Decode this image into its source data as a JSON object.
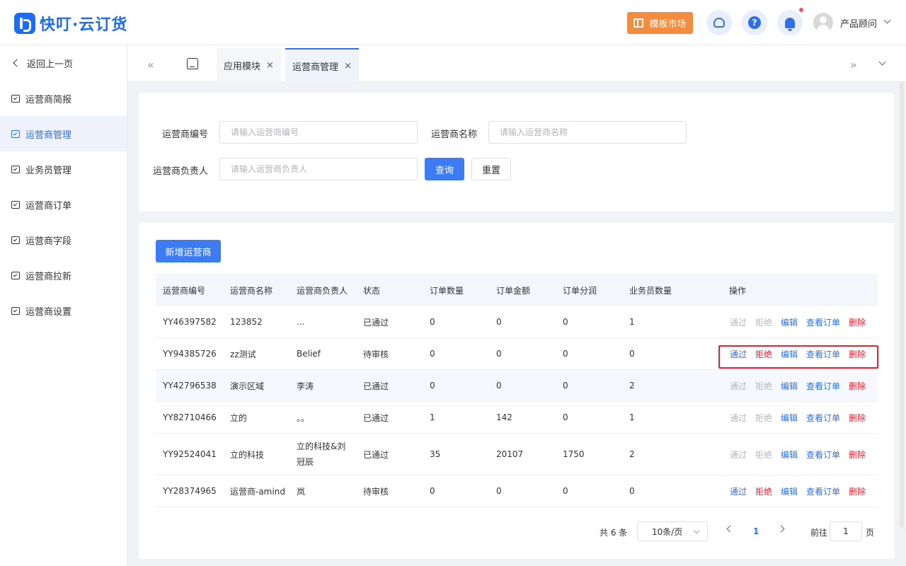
{
  "header": {
    "logo_text": "快叮·云订货",
    "template_market": "模板市场",
    "help_glyph": "?",
    "user_name": "产品顾问"
  },
  "sidebar": {
    "back": "返回上一页",
    "items": [
      {
        "label": "运营商简报"
      },
      {
        "label": "运营商管理"
      },
      {
        "label": "业务员管理"
      },
      {
        "label": "运营商订单"
      },
      {
        "label": "运营商字段"
      },
      {
        "label": "运营商拉新"
      },
      {
        "label": "运营商设置"
      }
    ]
  },
  "tabs": {
    "prev": "«",
    "next": "»",
    "close": "×",
    "items": [
      {
        "label": "应用模块"
      },
      {
        "label": "运营商管理"
      }
    ]
  },
  "filters": {
    "code_label": "运营商编号",
    "code_placeholder": "请输入运营商编号",
    "name_label": "运营商名称",
    "name_placeholder": "请输入运营商名称",
    "owner_label": "运营商负责人",
    "owner_placeholder": "请输入运营商负责人",
    "query": "查询",
    "reset": "重置"
  },
  "toolbar": {
    "add": "新增运营商"
  },
  "table": {
    "columns": [
      "运营商编号",
      "运营商名称",
      "运营商负责人",
      "状态",
      "订单数量",
      "订单金额",
      "订单分润",
      "业务员数量",
      "操作"
    ],
    "actions": {
      "approve": "通过",
      "reject": "拒绝",
      "edit": "编辑",
      "view_orders": "查看订单",
      "delete": "删除"
    },
    "rows": [
      {
        "code": "YY46397582",
        "name": "123852",
        "owner": "...",
        "status": "已通过",
        "orders": "0",
        "amount": "0",
        "profit": "0",
        "staff": "1"
      },
      {
        "code": "YY94385726",
        "name": "zz测试",
        "owner": "Belief",
        "status": "待审核",
        "orders": "0",
        "amount": "0",
        "profit": "0",
        "staff": "0"
      },
      {
        "code": "YY42796538",
        "name": "演示区域",
        "owner": "李涛",
        "status": "已通过",
        "orders": "0",
        "amount": "0",
        "profit": "0",
        "staff": "2"
      },
      {
        "code": "YY82710466",
        "name": "立的",
        "owner": "。。",
        "status": "已通过",
        "orders": "1",
        "amount": "142",
        "profit": "0",
        "staff": "1"
      },
      {
        "code": "YY92524041",
        "name": "立的科技",
        "owner": "立的科技&刘冠辰",
        "status": "已通过",
        "orders": "35",
        "amount": "20107",
        "profit": "1750",
        "staff": "2"
      },
      {
        "code": "YY28374965",
        "name": "运营商-amind",
        "owner": "岚",
        "status": "待审核",
        "orders": "0",
        "amount": "0",
        "profit": "0",
        "staff": "0"
      }
    ]
  },
  "pagination": {
    "total": "共 6 条",
    "page_size": "10条/页",
    "current_page": "1",
    "goto_label": "前往",
    "goto_value": "1",
    "page_suffix": "页"
  },
  "colors": {
    "primary": "#3d7bf5",
    "accent_orange": "#f58b3c",
    "danger": "#e8202e",
    "disabled": "#b4b8bf"
  }
}
